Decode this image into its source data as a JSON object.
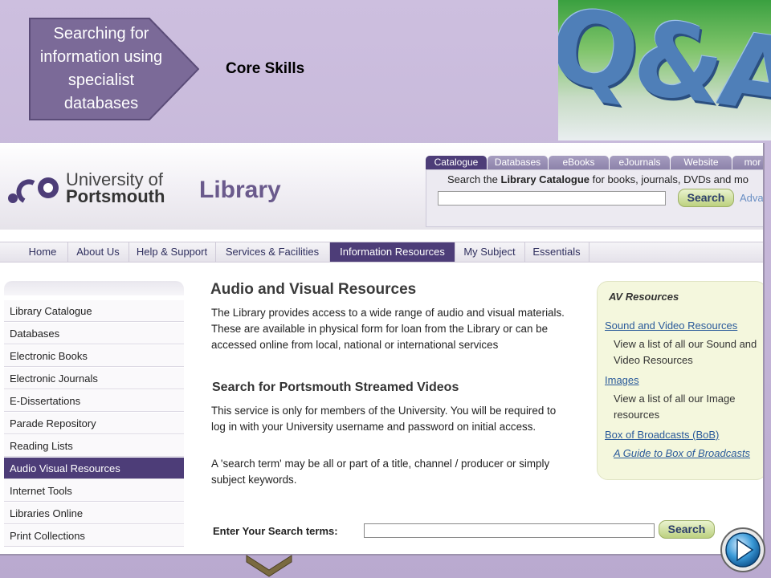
{
  "slide": {
    "arrow_label": "Searching for information using specialist databases",
    "core_skills": "Core Skills",
    "qa_graphic": "Q&A"
  },
  "site": {
    "logo_line1": "University of",
    "logo_line2": "Portsmouth",
    "library_title": "Library"
  },
  "search": {
    "tabs": [
      "Catalogue",
      "Databases",
      "eBooks",
      "eJournals",
      "Website",
      "mor"
    ],
    "caption_pre": "Search the",
    "caption_bold": "Library Catalogue",
    "caption_post": "for books, journals, DVDs and mo",
    "button": "Search",
    "advanced": "Adva"
  },
  "nav": [
    "Home",
    "About Us",
    "Help & Support",
    "Services & Facilities",
    "Information Resources",
    "My Subject",
    "Essentials"
  ],
  "sidebar": [
    "Library Catalogue",
    "Databases",
    "Electronic Books",
    "Electronic Journals",
    "E-Dissertations",
    "Parade Repository",
    "Reading Lists",
    "Audio Visual Resources",
    "Internet Tools",
    "Libraries Online",
    "Print Collections"
  ],
  "main": {
    "title": "Audio and Visual Resources",
    "intro": "The Library provides access to a wide range of audio and visual materials. These are available in physical form for loan from the Library or can be accessed online from local, national or international services",
    "subheading": "Search for Portsmouth Streamed Videos",
    "service_note": "This service is only for members of the University. You will be required to log in with your University username and password on initial access.",
    "search_term_note": "A 'search term' may be all or part of a title, channel / producer or simply subject keywords.",
    "enter_label": "Enter Your Search terms:",
    "search_button": "Search"
  },
  "av_box": {
    "title": "AV Resources",
    "link1": "Sound and Video Resources",
    "text1": "View a list of all our Sound and Video Resources",
    "link2": "Images",
    "text2": "View a list of all our Image resources",
    "link3": "Box of Broadcasts (BoB)",
    "link4": "A Guide to Box of Broadcasts"
  },
  "colors": {
    "accent_purple": "#4d3d78",
    "slide_bg": "#c8bcd9",
    "arrow_fill": "#7b6a98",
    "link_blue": "#2a5a9a",
    "search_green": "#bcd17f",
    "av_box_bg": "#f4f7dd"
  },
  "icons": {
    "play": "play-icon",
    "logo": "portsmouth-logo-dots"
  }
}
